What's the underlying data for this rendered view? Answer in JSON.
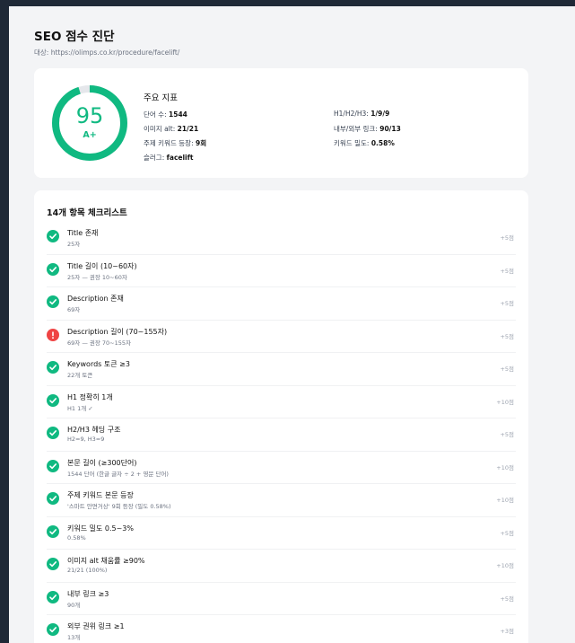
{
  "header": {
    "title": "SEO 점수 진단",
    "subtitle": "대상: https://olimps.co.kr/procedure/facelift/"
  },
  "score": {
    "value": "95",
    "grade": "A+",
    "progress": 0.95,
    "color": "#10b981"
  },
  "metrics": {
    "title": "주요 지표",
    "left": [
      {
        "label": "단어 수:",
        "value": "1544"
      },
      {
        "label": "이미지 alt:",
        "value": "21/21"
      },
      {
        "label": "주제 키워드 등장:",
        "value": "9회"
      },
      {
        "label": "슬러그:",
        "value": "facelift"
      }
    ],
    "right": [
      {
        "label": "H1/H2/H3:",
        "value": "1/9/9"
      },
      {
        "label": "내부/외부 링크:",
        "value": "90/13"
      },
      {
        "label": "키워드 밀도:",
        "value": "0.58%"
      }
    ]
  },
  "checklist": {
    "title": "14개 항목 체크리스트",
    "items": [
      {
        "label": "Title 존재",
        "detail": "25자",
        "points": "+5점",
        "status": "pass"
      },
      {
        "label": "Title 길이 (10~60자)",
        "detail": "25자 — 권장 10~60자",
        "points": "+5점",
        "status": "pass"
      },
      {
        "label": "Description 존재",
        "detail": "69자",
        "points": "+5점",
        "status": "pass"
      },
      {
        "label": "Description 길이 (70~155자)",
        "detail": "69자 — 권장 70~155자",
        "points": "+5점",
        "status": "fail"
      },
      {
        "label": "Keywords 토큰 ≥3",
        "detail": "22개 토큰",
        "points": "+5점",
        "status": "pass"
      },
      {
        "label": "H1 정확히 1개",
        "detail": "H1 1개 ✓",
        "points": "+10점",
        "status": "pass"
      },
      {
        "label": "H2/H3 헤딩 구조",
        "detail": "H2=9, H3=9",
        "points": "+5점",
        "status": "pass"
      },
      {
        "label": "본문 길이 (≥300단어)",
        "detail": "1544 단어 (한글 글자 ÷ 2 + 영문 단어)",
        "points": "+10점",
        "status": "pass"
      },
      {
        "label": "주제 키워드 본문 등장",
        "detail": "'스마트 안면거상' 9회 등장 (밀도 0.58%)",
        "points": "+10점",
        "status": "pass"
      },
      {
        "label": "키워드 밀도 0.5~3%",
        "detail": "0.58%",
        "points": "+5점",
        "status": "pass"
      },
      {
        "label": "이미지 alt 채움률 ≥90%",
        "detail": "21/21 (100%)",
        "points": "+10점",
        "status": "pass"
      },
      {
        "label": "내부 링크 ≥3",
        "detail": "90개",
        "points": "+5점",
        "status": "pass"
      },
      {
        "label": "외부 권위 링크 ≥1",
        "detail": "13개",
        "points": "+3점",
        "status": "pass"
      }
    ]
  }
}
